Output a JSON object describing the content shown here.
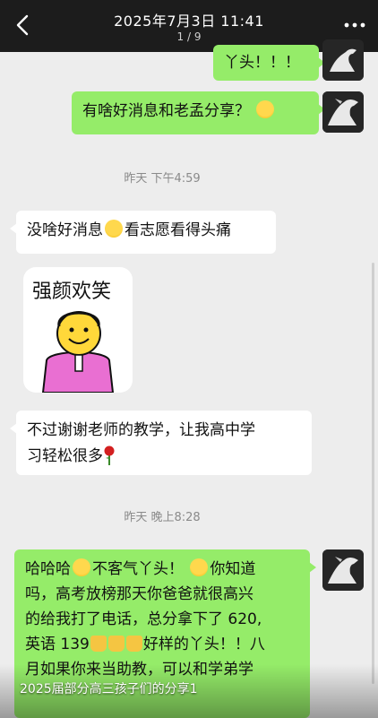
{
  "header": {
    "title": "2025年7月3日 11:41",
    "counter": "1 / 9"
  },
  "messages": {
    "m1": "丫头！！！",
    "m2": "有啥好消息和老孟分享？",
    "t1": "昨天 下午4:59",
    "m3a": "没啥好消息",
    "m3b": "看志愿看得头痛",
    "sticker_text": "强颜欢笑",
    "m4a": "不过谢谢老师的教学，让我高中学",
    "m4b": "习轻松很多",
    "t2": "昨天 晚上8:28",
    "m5_line1a": "哈哈哈",
    "m5_line1b": "不客气丫头！",
    "m5_line1c": "你知道",
    "m5_line2": "吗，高考放榜那天你爸爸就很高兴",
    "m5_line3": "的给我打了电话，总分拿下了 620,",
    "m5_line4a": "英语 139",
    "m5_line4b": "好样的丫头！！八",
    "m5_line5": "月如果你来当助教，可以和学弟学"
  },
  "caption": "2025届部分高三孩子们的分享1",
  "colors": {
    "self_bubble": "#95ec69",
    "other_bubble": "#ffffff",
    "background": "#ededed",
    "topbar": "#1c1c1c"
  },
  "icons": [
    "back-arrow-icon",
    "more-options-icon",
    "horse-avatar",
    "grin-emoji",
    "sweat-emoji",
    "thumbs-up-icon",
    "rose-icon"
  ]
}
